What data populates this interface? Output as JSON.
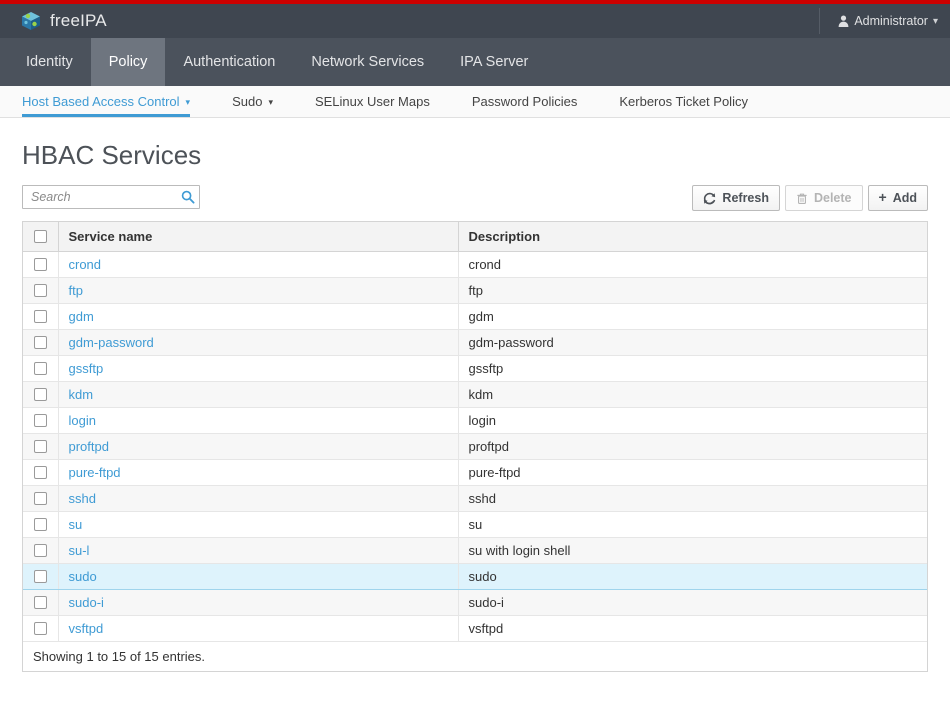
{
  "masthead": {
    "brand": "freeIPA",
    "brand_logo_icon": "ipa-cube-logo-icon",
    "user_icon": "user-icon",
    "user_label": "Administrator",
    "user_caret_icon": "chevron-down-icon",
    "accent_red": "#cc0000",
    "bar_color": "#3f4650"
  },
  "primary_nav": {
    "items": [
      {
        "label": "Identity",
        "active": false
      },
      {
        "label": "Policy",
        "active": true
      },
      {
        "label": "Authentication",
        "active": false
      },
      {
        "label": "Network Services",
        "active": false
      },
      {
        "label": "IPA Server",
        "active": false
      }
    ]
  },
  "secondary_nav": {
    "items": [
      {
        "label": "Host Based Access Control",
        "active": true,
        "caret": true
      },
      {
        "label": "Sudo",
        "active": false,
        "caret": true
      },
      {
        "label": "SELinux User Maps",
        "active": false,
        "caret": false
      },
      {
        "label": "Password Policies",
        "active": false,
        "caret": false
      },
      {
        "label": "Kerberos Ticket Policy",
        "active": false,
        "caret": false
      }
    ],
    "active_color": "#3f9bd4"
  },
  "page": {
    "title": "HBAC Services"
  },
  "toolbar": {
    "search_value": "",
    "search_placeholder": "Search",
    "search_icon": "search-icon",
    "refresh_label": "Refresh",
    "refresh_icon": "refresh-icon",
    "delete_label": "Delete",
    "delete_icon": "trash-icon",
    "delete_disabled": true,
    "add_label": "Add",
    "add_icon": "plus-icon"
  },
  "table": {
    "columns": [
      "Service name",
      "Description"
    ],
    "select_all_checked": false,
    "rows": [
      {
        "name": "crond",
        "description": "crond",
        "selected": false
      },
      {
        "name": "ftp",
        "description": "ftp",
        "selected": false
      },
      {
        "name": "gdm",
        "description": "gdm",
        "selected": false
      },
      {
        "name": "gdm-password",
        "description": "gdm-password",
        "selected": false
      },
      {
        "name": "gssftp",
        "description": "gssftp",
        "selected": false
      },
      {
        "name": "kdm",
        "description": "kdm",
        "selected": false
      },
      {
        "name": "login",
        "description": "login",
        "selected": false
      },
      {
        "name": "proftpd",
        "description": "proftpd",
        "selected": false
      },
      {
        "name": "pure-ftpd",
        "description": "pure-ftpd",
        "selected": false
      },
      {
        "name": "sshd",
        "description": "sshd",
        "selected": false
      },
      {
        "name": "su",
        "description": "su",
        "selected": false
      },
      {
        "name": "su-l",
        "description": "su with login shell",
        "selected": false
      },
      {
        "name": "sudo",
        "description": "sudo",
        "selected": true
      },
      {
        "name": "sudo-i",
        "description": "sudo-i",
        "selected": false
      },
      {
        "name": "vsftpd",
        "description": "vsftpd",
        "selected": false
      }
    ],
    "footer": "Showing 1 to 15 of 15 entries."
  }
}
